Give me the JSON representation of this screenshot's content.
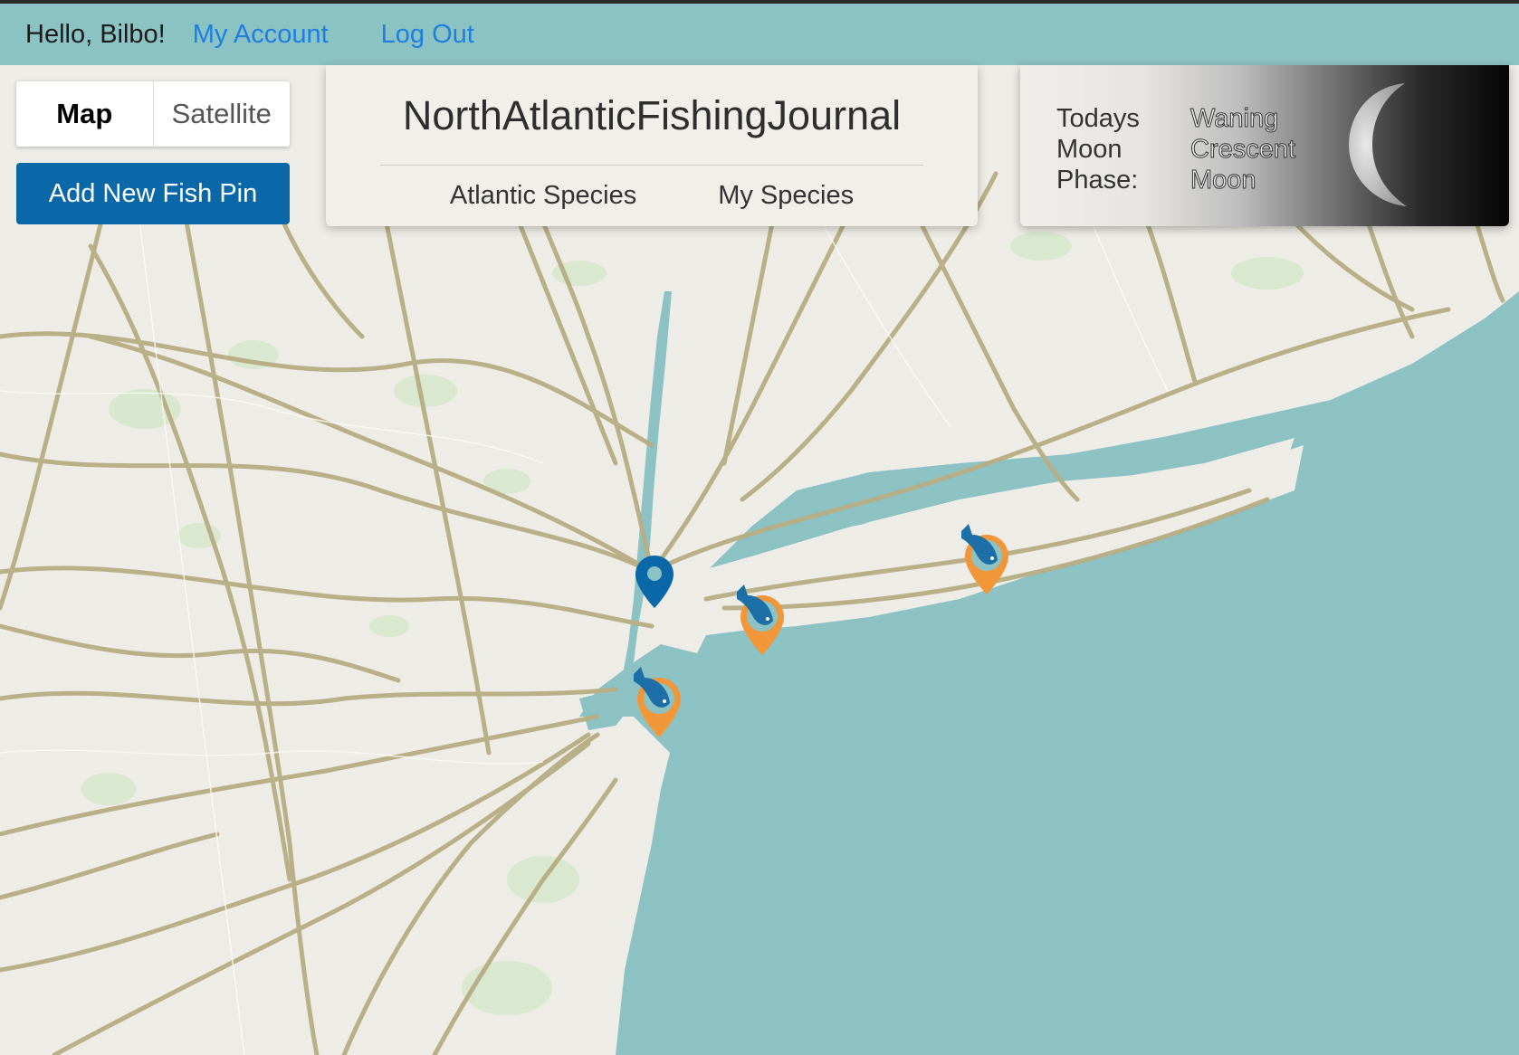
{
  "header": {
    "greeting": "Hello, Bilbo!",
    "my_account": "My Account",
    "log_out": "Log Out"
  },
  "map_controls": {
    "map_label": "Map",
    "satellite_label": "Satellite",
    "selected": "Map",
    "add_pin_label": "Add New Fish Pin"
  },
  "title_card": {
    "title": "NorthAtlanticFishingJournal",
    "tabs": [
      "Atlantic Species",
      "My Species"
    ]
  },
  "moon_card": {
    "label_lines": [
      "Todays",
      "Moon",
      "Phase:"
    ],
    "phase_lines": [
      "Waning",
      "Crescent",
      "Moon"
    ]
  },
  "colors": {
    "header_bg": "#8bc2c4",
    "link": "#1e7fe0",
    "water": "#8cc2c4",
    "land": "#eeece6",
    "roads": "#b8ad84",
    "add_pin_button": "#0a67a8",
    "fish_pin_orange": "#f2963a",
    "location_pin_blue": "#0a67a8"
  },
  "markers": [
    {
      "type": "current-location",
      "icon": "location-pin-icon"
    },
    {
      "type": "fish-pin",
      "icon": "fish-icon"
    },
    {
      "type": "fish-pin",
      "icon": "fish-icon"
    },
    {
      "type": "fish-pin",
      "icon": "fish-icon"
    }
  ]
}
